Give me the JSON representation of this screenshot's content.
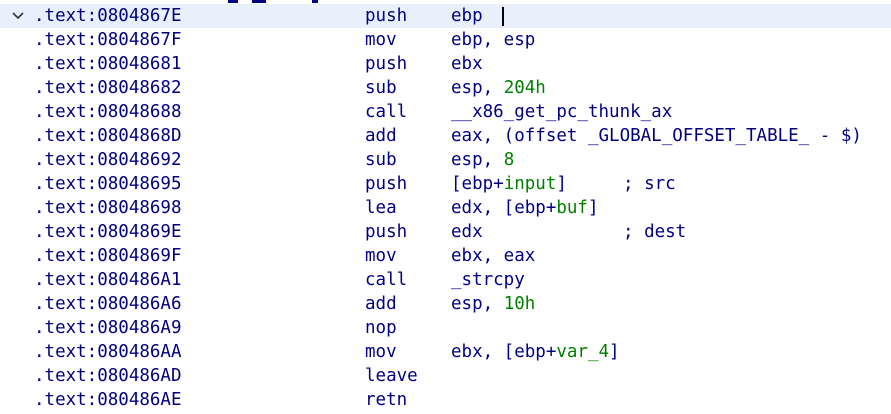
{
  "window": {
    "colors": {
      "text": "#000080",
      "number": "#008000",
      "background": "#ffffff",
      "active_row": "#e8f1fb"
    }
  },
  "listing": {
    "fold_icon": "chevron-down-icon",
    "rows": [
      {
        "addr": ".text:0804867E",
        "mnem": "push",
        "ops": [
          {
            "t": "ebp"
          }
        ],
        "comment": ""
      },
      {
        "addr": ".text:0804867F",
        "mnem": "mov",
        "ops": [
          {
            "t": "ebp, esp"
          }
        ],
        "comment": ""
      },
      {
        "addr": ".text:08048681",
        "mnem": "push",
        "ops": [
          {
            "t": "ebx"
          }
        ],
        "comment": ""
      },
      {
        "addr": ".text:08048682",
        "mnem": "sub",
        "ops": [
          {
            "t": "esp, "
          },
          {
            "t": "204h",
            "num": true
          }
        ],
        "comment": ""
      },
      {
        "addr": ".text:08048688",
        "mnem": "call",
        "ops": [
          {
            "t": "__x86_get_pc_thunk_ax"
          }
        ],
        "comment": ""
      },
      {
        "addr": ".text:0804868D",
        "mnem": "add",
        "ops": [
          {
            "t": "eax, (offset _GLOBAL_OFFSET_TABLE_ - $)"
          }
        ],
        "comment": ""
      },
      {
        "addr": ".text:08048692",
        "mnem": "sub",
        "ops": [
          {
            "t": "esp, "
          },
          {
            "t": "8",
            "num": true
          }
        ],
        "comment": ""
      },
      {
        "addr": ".text:08048695",
        "mnem": "push",
        "ops": [
          {
            "t": "[ebp+"
          },
          {
            "t": "input",
            "num": true
          },
          {
            "t": "]"
          }
        ],
        "comment": "; src"
      },
      {
        "addr": ".text:08048698",
        "mnem": "lea",
        "ops": [
          {
            "t": "edx, [ebp+"
          },
          {
            "t": "buf",
            "num": true
          },
          {
            "t": "]"
          }
        ],
        "comment": ""
      },
      {
        "addr": ".text:0804869E",
        "mnem": "push",
        "ops": [
          {
            "t": "edx"
          }
        ],
        "comment": "; dest"
      },
      {
        "addr": ".text:0804869F",
        "mnem": "mov",
        "ops": [
          {
            "t": "ebx, eax"
          }
        ],
        "comment": ""
      },
      {
        "addr": ".text:080486A1",
        "mnem": "call",
        "ops": [
          {
            "t": "_strcpy"
          }
        ],
        "comment": ""
      },
      {
        "addr": ".text:080486A6",
        "mnem": "add",
        "ops": [
          {
            "t": "esp, "
          },
          {
            "t": "10h",
            "num": true
          }
        ],
        "comment": ""
      },
      {
        "addr": ".text:080486A9",
        "mnem": "nop",
        "ops": [],
        "comment": ""
      },
      {
        "addr": ".text:080486AA",
        "mnem": "mov",
        "ops": [
          {
            "t": "ebx, [ebp+"
          },
          {
            "t": "var_4",
            "num": true
          },
          {
            "t": "]"
          }
        ],
        "comment": ""
      },
      {
        "addr": ".text:080486AD",
        "mnem": "leave",
        "ops": [],
        "comment": ""
      },
      {
        "addr": ".text:080486AE",
        "mnem": "retn",
        "ops": [],
        "comment": ""
      }
    ]
  }
}
